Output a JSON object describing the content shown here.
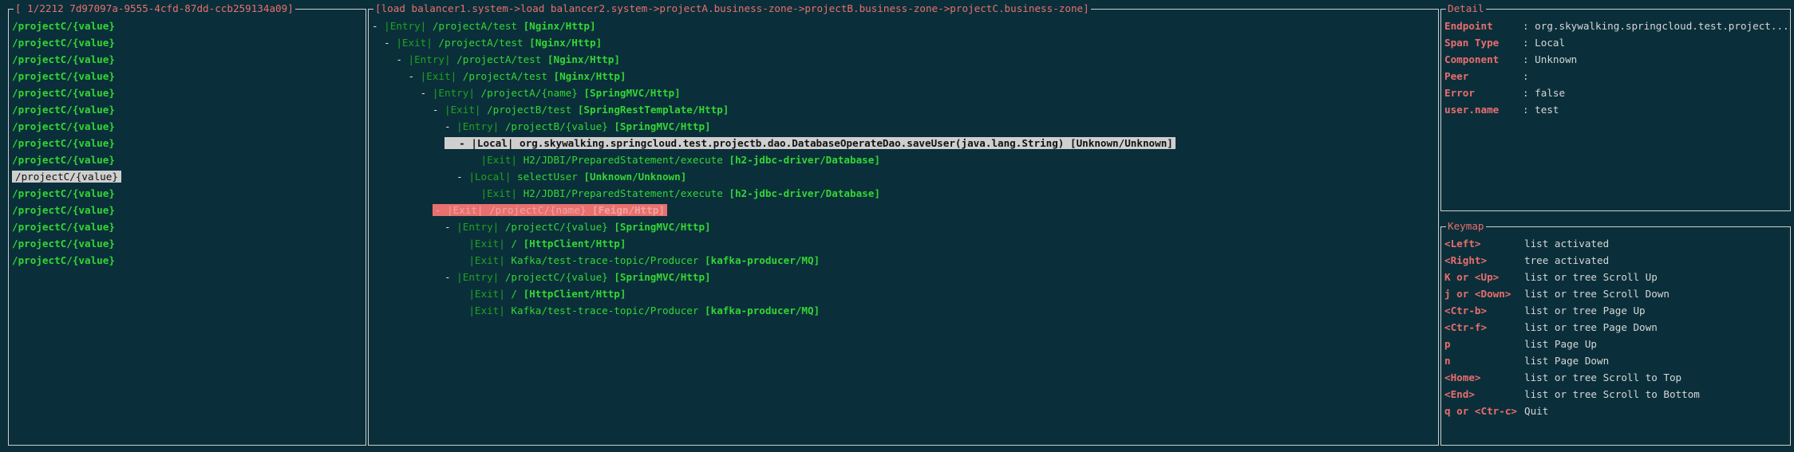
{
  "left_pane": {
    "title": "[ 1/2212  7d97097a-9555-4cfd-87dd-ccb259134a09]",
    "items": [
      "/projectC/{value}",
      "/projectC/{value}",
      "/projectC/{value}",
      "/projectC/{value}",
      "/projectC/{value}",
      "/projectC/{value}",
      "/projectC/{value}",
      "/projectC/{value}",
      "/projectC/{value}",
      "/projectC/{value}",
      "/projectC/{value}",
      "/projectC/{value}",
      "/projectC/{value}",
      "/projectC/{value}",
      "/projectC/{value}"
    ],
    "selected_index": 9
  },
  "tree_pane": {
    "title": "[load balancer1.system->load balancer2.system->projectA.business-zone->projectB.business-zone->projectC.business-zone]",
    "nodes": [
      {
        "prefix": "- ",
        "kind": "|Entry|",
        "name": " /projectA/test ",
        "comp": "[Nginx/Http]",
        "indent": 0,
        "state": "normal"
      },
      {
        "prefix": "- ",
        "kind": "|Exit|",
        "name": " /projectA/test ",
        "comp": "[Nginx/Http]",
        "indent": 1,
        "state": "normal"
      },
      {
        "prefix": "- ",
        "kind": "|Entry|",
        "name": " /projectA/test ",
        "comp": "[Nginx/Http]",
        "indent": 2,
        "state": "normal"
      },
      {
        "prefix": "- ",
        "kind": "|Exit|",
        "name": " /projectA/test ",
        "comp": "[Nginx/Http]",
        "indent": 3,
        "state": "normal"
      },
      {
        "prefix": "- ",
        "kind": "|Entry|",
        "name": " /projectA/{name} ",
        "comp": "[SpringMVC/Http]",
        "indent": 4,
        "state": "normal"
      },
      {
        "prefix": "- ",
        "kind": "|Exit|",
        "name": " /projectB/test ",
        "comp": "[SpringRestTemplate/Http]",
        "indent": 5,
        "state": "normal"
      },
      {
        "prefix": "- ",
        "kind": "|Entry|",
        "name": " /projectB/{value} ",
        "comp": "[SpringMVC/Http]",
        "indent": 6,
        "state": "normal"
      },
      {
        "prefix": "  - ",
        "kind": "|Local|",
        "name": " org.skywalking.springcloud.test.projectb.dao.DatabaseOperateDao.saveUser(java.lang.String) ",
        "comp": "[Unknown/Unknown]",
        "indent": 6,
        "state": "selected"
      },
      {
        "prefix": "",
        "kind": "|Exit|",
        "name": " H2/JDBI/PreparedStatement/execute ",
        "comp": "[h2-jdbc-driver/Database]",
        "indent": 9,
        "state": "normal"
      },
      {
        "prefix": "- ",
        "kind": "|Local|",
        "name": " selectUser ",
        "comp": "[Unknown/Unknown]",
        "indent": 7,
        "state": "normal"
      },
      {
        "prefix": "",
        "kind": "|Exit|",
        "name": " H2/JDBI/PreparedStatement/execute ",
        "comp": "[h2-jdbc-driver/Database]",
        "indent": 9,
        "state": "normal"
      },
      {
        "prefix": "- ",
        "kind": "|Exit|",
        "name": " /projectC/{name} ",
        "comp": "[Feign/Http]",
        "indent": 5,
        "state": "error"
      },
      {
        "prefix": "- ",
        "kind": "|Entry|",
        "name": " /projectC/{value} ",
        "comp": "[SpringMVC/Http]",
        "indent": 6,
        "state": "normal"
      },
      {
        "prefix": "",
        "kind": "|Exit|",
        "name": " / ",
        "comp": "[HttpClient/Http]",
        "indent": 8,
        "state": "normal"
      },
      {
        "prefix": "",
        "kind": "|Exit|",
        "name": " Kafka/test-trace-topic/Producer ",
        "comp": "[kafka-producer/MQ]",
        "indent": 8,
        "state": "normal"
      },
      {
        "prefix": "- ",
        "kind": "|Entry|",
        "name": " /projectC/{value} ",
        "comp": "[SpringMVC/Http]",
        "indent": 6,
        "state": "normal"
      },
      {
        "prefix": "",
        "kind": "|Exit|",
        "name": " / ",
        "comp": "[HttpClient/Http]",
        "indent": 8,
        "state": "normal"
      },
      {
        "prefix": "",
        "kind": "|Exit|",
        "name": " Kafka/test-trace-topic/Producer ",
        "comp": "[kafka-producer/MQ]",
        "indent": 8,
        "state": "normal"
      }
    ]
  },
  "detail_pane": {
    "title": " Detail ",
    "rows": [
      {
        "label": "Endpoint",
        "value": ": org.skywalking.springcloud.test.project..."
      },
      {
        "label": "Span Type",
        "value": ": Local"
      },
      {
        "label": "Component",
        "value": ": Unknown"
      },
      {
        "label": "Peer",
        "value": ":"
      },
      {
        "label": "Error",
        "value": ": false"
      },
      {
        "label": "user.name",
        "value": ": test"
      }
    ]
  },
  "keymap_pane": {
    "title": " Keymap ",
    "rows": [
      {
        "key": "<Left>",
        "desc": "list activated"
      },
      {
        "key": "<Right>",
        "desc": "tree activated"
      },
      {
        "key": "K or <Up>",
        "desc": "list or tree Scroll Up"
      },
      {
        "key": "j or <Down>",
        "desc": "list or tree Scroll Down"
      },
      {
        "key": "<Ctr-b>",
        "desc": "list or tree Page Up"
      },
      {
        "key": "<Ctr-f>",
        "desc": "list or tree Page Down"
      },
      {
        "key": "p",
        "desc": "list Page Up"
      },
      {
        "key": "n",
        "desc": "list Page Down"
      },
      {
        "key": "<Home>",
        "desc": "list or tree Scroll to Top"
      },
      {
        "key": "<End>",
        "desc": "list or tree Scroll to Bottom"
      },
      {
        "key": "q or <Ctr-c>",
        "desc": "Quit"
      }
    ]
  },
  "colors": {
    "background": "#0a2f3a",
    "border": "#cfcfcf",
    "accent_red": "#ea6d6d",
    "green": "#34d634",
    "dark_green": "#1fa31f",
    "selection": "#cfcfcf",
    "error_bg": "#e8706e"
  }
}
